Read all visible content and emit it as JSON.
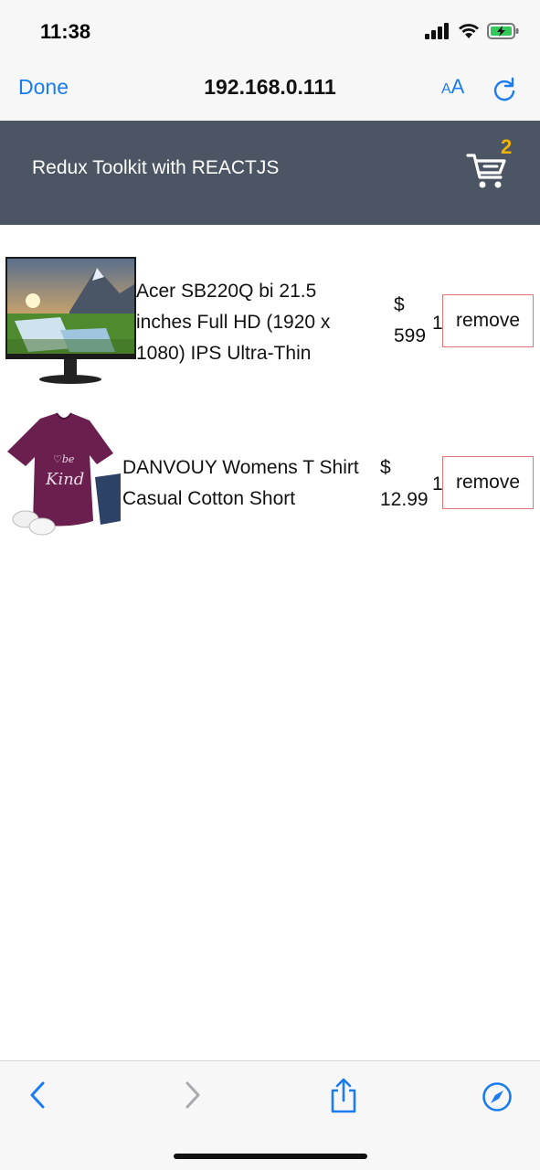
{
  "status_bar": {
    "time": "11:38"
  },
  "browser": {
    "done_label": "Done",
    "url": "192.168.0.111",
    "text_size_label_small": "A",
    "text_size_label_large": "A"
  },
  "app": {
    "title": "Redux Toolkit with REACTJS",
    "cart_count": "2"
  },
  "cart_items": [
    {
      "title_lines": [
        "Acer SB220Q bi 21.5",
        "inches Full HD (1920 x",
        "1080) IPS Ultra-Thin"
      ],
      "price_symbol": "$",
      "price_value": "599",
      "quantity": "1",
      "remove_label": "remove"
    },
    {
      "title_lines": [
        "DANVOUY Womens T Shirt",
        "Casual Cotton Short"
      ],
      "price_symbol": "$",
      "price_value": "12.99",
      "quantity": "1",
      "remove_label": "remove"
    }
  ],
  "colors": {
    "accent": "#1a7cf0",
    "header_bg": "#4b5563",
    "cart_badge": "#f5b400",
    "remove_border": "#e57373"
  },
  "icons": {
    "cart": "shopping-cart-icon",
    "back": "chevron-left-icon",
    "forward": "chevron-right-icon",
    "share": "share-icon",
    "compass": "compass-icon",
    "reload": "reload-icon"
  }
}
